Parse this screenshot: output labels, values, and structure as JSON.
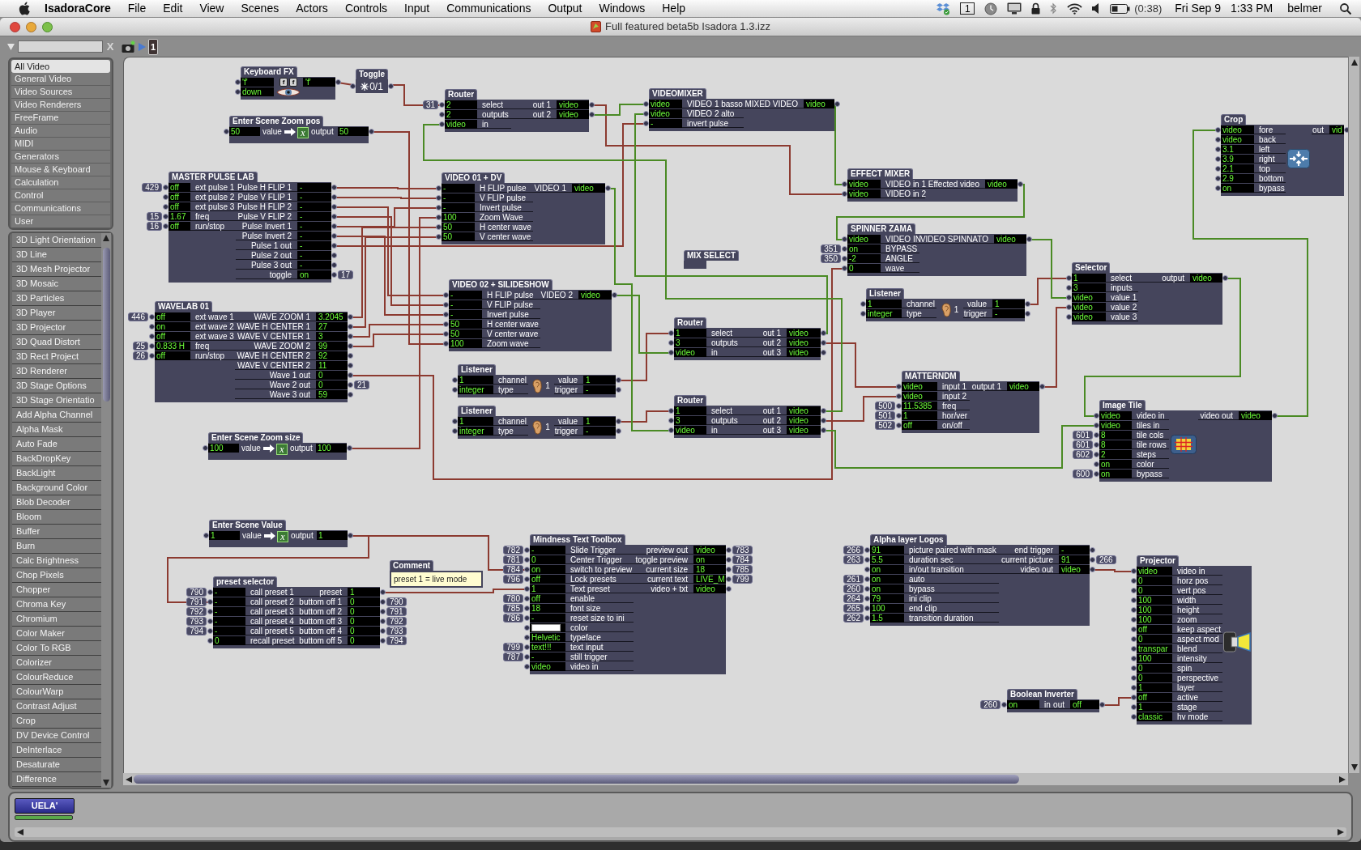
{
  "menu_bar": {
    "app": "IsadoraCore",
    "menus": [
      "File",
      "Edit",
      "View",
      "Scenes",
      "Actors",
      "Controls",
      "Input",
      "Communications",
      "Output",
      "Windows",
      "Help"
    ],
    "space": "1",
    "battery": "(0:38)",
    "date": "Fri Sep 9",
    "time": "1:33 PM",
    "user": "belmer"
  },
  "window": {
    "title": "Full featured beta5b Isadora 1.3.izz"
  },
  "toolbar": {
    "clear": "X",
    "page": "1"
  },
  "sidebar": {
    "categories": [
      {
        "label": "All Video",
        "selected": true
      },
      {
        "label": "General Video",
        "selected": false
      },
      {
        "label": "Video Sources",
        "selected": false
      },
      {
        "label": "Video Renderers",
        "selected": false
      },
      {
        "label": "FreeFrame",
        "selected": false
      },
      {
        "label": "Audio",
        "selected": false
      },
      {
        "label": "MIDI",
        "selected": false
      },
      {
        "label": "Generators",
        "selected": false
      },
      {
        "label": "Mouse & Keyboard",
        "selected": false
      },
      {
        "label": "Calculation",
        "selected": false
      },
      {
        "label": "Control",
        "selected": false
      },
      {
        "label": "Communications",
        "selected": false
      },
      {
        "label": "User",
        "selected": false
      }
    ],
    "actors": [
      "3D Light Orientation",
      "3D Line",
      "3D Mesh Projector",
      "3D Mosaic",
      "3D Particles",
      "3D Player",
      "3D Projector",
      "3D Quad Distort",
      "3D Rect Project",
      "3D Renderer",
      "3D Stage Options",
      "3D Stage Orientatio",
      "Add Alpha Channel",
      "Alpha Mask",
      "Auto Fade",
      "BackDropKey",
      "BackLight",
      "Background Color",
      "Blob Decoder",
      "Bloom",
      "Buffer",
      "Burn",
      "Calc Brightness",
      "Chop Pixels",
      "Chopper",
      "Chroma Key",
      "Chromium",
      "Color Maker",
      "Color To RGB",
      "Colorizer",
      "ColourReduce",
      "ColourWarp",
      "Contrast Adjust",
      "Crop",
      "DV Device Control",
      "DeInterlace",
      "Desaturate",
      "Difference"
    ]
  },
  "patch": {
    "actors": [
      {
        "title": "Keyboard FX",
        "kind": "ports",
        "keys": [
          "f",
          "f"
        ],
        "inputs": [
          {
            "value": "'f'"
          },
          {
            "value": "down"
          }
        ],
        "outputs": [
          {
            "value": "'f'"
          }
        ]
      },
      {
        "title": "Toggle",
        "kind": "toggle",
        "value": "0/1"
      },
      {
        "title": "Router",
        "kind": "ports",
        "inputs": [
          {
            "value": "2",
            "label": "select",
            "link": "31"
          },
          {
            "value": "2",
            "label": "outputs"
          },
          {
            "value": "video",
            "label": "in"
          }
        ],
        "outputs": [
          {
            "label": "out 1",
            "value": "video"
          },
          {
            "label": "out 2",
            "value": "video"
          }
        ]
      },
      {
        "title": "VIDEOMIXER",
        "kind": "ports",
        "inputs": [
          {
            "value": "video",
            "label": "VIDEO 1 basso"
          },
          {
            "value": "video",
            "label": "VIDEO 2 alto"
          },
          {
            "value": "-",
            "label": "invert pulse"
          }
        ],
        "outputs": [
          {
            "label": "MIXED VIDEO",
            "value": "video"
          }
        ]
      },
      {
        "title": "Enter Scene Zoom pos",
        "kind": "scene-value",
        "value": "50",
        "value_label": "value",
        "symbol": "x",
        "output_label": "output",
        "output": "50"
      },
      {
        "title": "Crop",
        "kind": "ports",
        "inputs": [
          {
            "value": "video",
            "label": "fore"
          },
          {
            "value": "video",
            "label": "back"
          },
          {
            "value": "3.1",
            "label": "left"
          },
          {
            "value": "3.9",
            "label": "right"
          },
          {
            "value": "2.1",
            "label": "top"
          },
          {
            "value": "2.9",
            "label": "bottom"
          },
          {
            "value": "on",
            "label": "bypass"
          }
        ],
        "outputs": [
          {
            "label": "out",
            "value": "vid"
          }
        ]
      },
      {
        "title": "MASTER PULSE LAB",
        "kind": "ports",
        "inputs": [
          {
            "value": "off",
            "label": "ext pulse 1",
            "link": "429"
          },
          {
            "value": "off",
            "label": "ext pulse 2"
          },
          {
            "value": "off",
            "label": "ext pulse 3"
          },
          {
            "value": "1.67",
            "label": "freq",
            "link": "15"
          },
          {
            "value": "off",
            "label": "run/stop",
            "link": "16"
          }
        ],
        "outputs": [
          {
            "label": "Pulse H FLIP 1",
            "value": "-"
          },
          {
            "label": "Pulse V FLIP 1",
            "value": "-"
          },
          {
            "label": "Pulse H FLIP 2",
            "value": "-"
          },
          {
            "label": "Pulse V FLIP 2",
            "value": "-"
          },
          {
            "label": "Pulse Invert 1",
            "value": "-"
          },
          {
            "label": "Pulse Invert 2",
            "value": "-"
          },
          {
            "label": "Pulse 1 out",
            "value": "-"
          },
          {
            "label": "Pulse 2 out",
            "value": "-"
          },
          {
            "label": "Pulse 3 out",
            "value": "-"
          },
          {
            "label": "toggle",
            "value": "on",
            "link": "17"
          }
        ]
      },
      {
        "title": "VIDEO 01 + DV",
        "kind": "ports",
        "inputs": [
          {
            "value": "-",
            "label": "H FLIP pulse"
          },
          {
            "value": "-",
            "label": "V FLIP pulse"
          },
          {
            "value": "-",
            "label": "Invert pulse"
          },
          {
            "value": "100",
            "label": "Zoom Wave"
          },
          {
            "value": "50",
            "label": "H center wave"
          },
          {
            "value": "50",
            "label": "V center wave"
          }
        ],
        "outputs": [
          {
            "label": "VIDEO 1",
            "value": "video"
          }
        ]
      },
      {
        "title": "EFFECT MIXER",
        "kind": "ports",
        "inputs": [
          {
            "value": "video",
            "label": "VIDEO in 1"
          },
          {
            "value": "video",
            "label": "VIDEO in 2"
          }
        ],
        "outputs": [
          {
            "label": "Effected video",
            "value": "video"
          }
        ]
      },
      {
        "title": "SPINNER ZAMA",
        "kind": "ports",
        "inputs": [
          {
            "value": "video",
            "label": "VIDEO IN"
          },
          {
            "value": "on",
            "label": "BYPASS",
            "link": "351"
          },
          {
            "value": "-2",
            "label": "ANGLE",
            "link": "350"
          },
          {
            "value": "0",
            "label": "wave"
          }
        ],
        "outputs": [
          {
            "label": "VIDEO SPINNATO",
            "value": "video"
          }
        ]
      },
      {
        "title": "MIX SELECT",
        "kind": "label"
      },
      {
        "title": "Selector",
        "kind": "ports",
        "inputs": [
          {
            "value": "1",
            "label": "select"
          },
          {
            "value": "3",
            "label": "inputs"
          },
          {
            "value": "video",
            "label": "value 1"
          },
          {
            "value": "video",
            "label": "value 2"
          },
          {
            "value": "video",
            "label": "value 3"
          }
        ],
        "outputs": [
          {
            "label": "output",
            "value": "video"
          }
        ]
      },
      {
        "title": "VIDEO 02 + SILIDESHOW",
        "kind": "ports",
        "inputs": [
          {
            "value": "-",
            "label": "H FLIP pulse"
          },
          {
            "value": "-",
            "label": "V FLIP pulse"
          },
          {
            "value": "-",
            "label": "Invert pulse"
          },
          {
            "value": "50",
            "label": "H center wave"
          },
          {
            "value": "50",
            "label": "V center wave"
          },
          {
            "value": "100",
            "label": "Zoom wave"
          }
        ],
        "outputs": [
          {
            "label": "VIDEO 2",
            "value": "video"
          }
        ]
      },
      {
        "title": "Listener",
        "kind": "ports",
        "readout": "1",
        "inputs": [
          {
            "value": "1",
            "label": "channel"
          },
          {
            "value": "integer",
            "label": "type"
          }
        ],
        "outputs": [
          {
            "label": "value",
            "value": "1"
          },
          {
            "label": "trigger",
            "value": "-"
          }
        ]
      },
      {
        "title": "WAVELAB 01",
        "kind": "ports",
        "inputs": [
          {
            "value": "off",
            "label": "ext wave 1",
            "link": "446"
          },
          {
            "value": "on",
            "label": "ext wave 2"
          },
          {
            "value": "off",
            "label": "ext wave 3"
          },
          {
            "value": "0.833 H",
            "label": "freq",
            "link": "25"
          },
          {
            "value": "off",
            "label": "run/stop",
            "link": "26"
          }
        ],
        "outputs": [
          {
            "label": "WAVE ZOOM 1",
            "value": "3.2045"
          },
          {
            "label": "WAVE H CENTER 1",
            "value": "27"
          },
          {
            "label": "WAVE V CENTER 1",
            "value": "3"
          },
          {
            "label": "WAVE ZOOM 2",
            "value": "99"
          },
          {
            "label": "WAVE H CENTER 2",
            "value": "92"
          },
          {
            "label": "WAVE V CENTER 2",
            "value": "11"
          },
          {
            "label": "Wave 1 out",
            "value": "0"
          },
          {
            "label": "Wave 2 out",
            "value": "0",
            "link": "21"
          },
          {
            "label": "Wave 3 out",
            "value": "59"
          }
        ]
      },
      {
        "title": "Router",
        "kind": "ports",
        "inputs": [
          {
            "value": "1",
            "label": "select"
          },
          {
            "value": "3",
            "label": "outputs"
          },
          {
            "value": "video",
            "label": "in"
          }
        ],
        "outputs": [
          {
            "label": "out 1",
            "value": "video"
          },
          {
            "label": "out 2",
            "value": "video"
          },
          {
            "label": "out 3",
            "value": "video"
          }
        ]
      },
      {
        "title": "Listener",
        "kind": "ports",
        "readout": "1",
        "inputs": [
          {
            "value": "1",
            "label": "channel"
          },
          {
            "value": "integer",
            "label": "type"
          }
        ],
        "outputs": [
          {
            "label": "value",
            "value": "1"
          },
          {
            "label": "trigger",
            "value": "-"
          }
        ]
      },
      {
        "title": "MATTERNDM",
        "kind": "ports",
        "inputs": [
          {
            "value": "video",
            "label": "input 1"
          },
          {
            "value": "video",
            "label": "input 2"
          },
          {
            "value": "11.5385",
            "label": "freq",
            "link": "500"
          },
          {
            "value": "1",
            "label": "hor/ver",
            "link": "501"
          },
          {
            "value": "off",
            "label": "on/off",
            "link": "502"
          }
        ],
        "outputs": [
          {
            "label": "output 1",
            "value": "video"
          }
        ]
      },
      {
        "title": "Router",
        "kind": "ports",
        "inputs": [
          {
            "value": "1",
            "label": "select"
          },
          {
            "value": "3",
            "label": "outputs"
          },
          {
            "value": "video",
            "label": "in"
          }
        ],
        "outputs": [
          {
            "label": "out 1",
            "value": "video"
          },
          {
            "label": "out 2",
            "value": "video"
          },
          {
            "label": "out 3",
            "value": "video"
          }
        ]
      },
      {
        "title": "Image Tile",
        "kind": "ports",
        "inputs": [
          {
            "value": "video",
            "label": "video in"
          },
          {
            "value": "video",
            "label": "tiles in"
          },
          {
            "value": "8",
            "label": "tile cols",
            "link": "601"
          },
          {
            "value": "8",
            "label": "tile rows",
            "link": "601"
          },
          {
            "value": "2",
            "label": "steps",
            "link": "602"
          },
          {
            "value": "on",
            "label": "color"
          },
          {
            "value": "on",
            "label": "bypass",
            "link": "600"
          }
        ],
        "outputs": [
          {
            "label": "video out",
            "value": "video"
          }
        ]
      },
      {
        "title": "Listener",
        "kind": "ports",
        "readout": "1",
        "inputs": [
          {
            "value": "1",
            "label": "channel"
          },
          {
            "value": "integer",
            "label": "type"
          }
        ],
        "outputs": [
          {
            "label": "value",
            "value": "1"
          },
          {
            "label": "trigger",
            "value": "-"
          }
        ]
      },
      {
        "title": "Enter Scene Zoom size",
        "kind": "scene-value",
        "value": "100",
        "value_label": "value",
        "symbol": "x",
        "output_label": "output",
        "output": "100"
      },
      {
        "title": "Enter Scene Value",
        "kind": "scene-value",
        "value": "1",
        "value_label": "value",
        "symbol": "x",
        "output_label": "output",
        "output": "1"
      },
      {
        "title": "Mindness Text Toolbox",
        "kind": "ports",
        "inputs": [
          {
            "value": "-",
            "label": "Slide Trigger",
            "link": "782"
          },
          {
            "value": "0",
            "label": "Center Trigger",
            "link": "781"
          },
          {
            "value": "on",
            "label": "switch to preview",
            "link": "784"
          },
          {
            "value": "off",
            "label": "Lock presets",
            "link": "796"
          },
          {
            "value": "1",
            "label": "Text preset"
          },
          {
            "value": "off",
            "label": "enable",
            "link": "780"
          },
          {
            "value": "18",
            "label": "font size",
            "link": "785"
          },
          {
            "value": "-",
            "label": "reset size to ini",
            "link": "786"
          },
          {
            "color": "#ffffff",
            "label": "color"
          },
          {
            "value": "Helvetic",
            "label": "typeface"
          },
          {
            "value": "text!!!",
            "label": "text input",
            "link": "799"
          },
          {
            "value": "-",
            "label": "still trigger",
            "link": "787"
          },
          {
            "value": "video",
            "label": "video in"
          }
        ],
        "outputs": [
          {
            "label": "preview out",
            "value": "video",
            "link": "783"
          },
          {
            "label": "toggle preview",
            "value": "on",
            "link": "784"
          },
          {
            "label": "current size",
            "value": "18",
            "link": "785"
          },
          {
            "label": "current text",
            "value": "LIVE_M",
            "link": "799"
          },
          {
            "label": "video + txt",
            "value": "video"
          }
        ]
      },
      {
        "title": "Alpha layer Logos",
        "kind": "ports",
        "inputs": [
          {
            "value": "91",
            "label": "picture paired with mask",
            "link": "266"
          },
          {
            "value": "5.5",
            "label": "duration sec",
            "link": "263"
          },
          {
            "value": "on",
            "label": "in/out transition"
          },
          {
            "value": "on",
            "label": "auto",
            "link": "261"
          },
          {
            "value": "on",
            "label": "bypass",
            "link": "260"
          },
          {
            "value": "79",
            "label": "ini clip",
            "link": "264"
          },
          {
            "value": "100",
            "label": "end clip",
            "link": "265"
          },
          {
            "value": "1.5",
            "label": "transition duration",
            "link": "262"
          }
        ],
        "outputs": [
          {
            "label": "end trigger",
            "value": "-"
          },
          {
            "label": "current picture",
            "value": "91",
            "link": "266"
          },
          {
            "label": "video out",
            "value": "video"
          }
        ]
      },
      {
        "title": "Projector",
        "kind": "ports",
        "inputs": [
          {
            "value": "video",
            "label": "video in"
          },
          {
            "value": "0",
            "label": "horz pos"
          },
          {
            "value": "0",
            "label": "vert pos"
          },
          {
            "value": "100",
            "label": "width"
          },
          {
            "value": "100",
            "label": "height"
          },
          {
            "value": "100",
            "label": "zoom"
          },
          {
            "value": "off",
            "label": "keep aspect"
          },
          {
            "value": "0",
            "label": "aspect mod"
          },
          {
            "value": "transpar",
            "label": "blend"
          },
          {
            "value": "100",
            "label": "intensity"
          },
          {
            "value": "0",
            "label": "spin"
          },
          {
            "value": "0",
            "label": "perspective"
          },
          {
            "value": "1",
            "label": "layer"
          },
          {
            "value": "off",
            "label": "active"
          },
          {
            "value": "1",
            "label": "stage"
          },
          {
            "value": "classic",
            "label": "hv mode"
          }
        ]
      },
      {
        "title": "Comment",
        "kind": "comment",
        "text": "preset 1 = live mode"
      },
      {
        "title": "preset selector",
        "kind": "ports",
        "inputs": [
          {
            "value": "-",
            "label": "call preset 1",
            "link": "790"
          },
          {
            "value": "-",
            "label": "call preset 2",
            "link": "791"
          },
          {
            "value": "-",
            "label": "call preset 3",
            "link": "792"
          },
          {
            "value": "-",
            "label": "call preset 4",
            "link": "793"
          },
          {
            "value": "-",
            "label": "call preset 5",
            "link": "794"
          },
          {
            "value": "0",
            "label": "recall preset"
          }
        ],
        "outputs": [
          {
            "label": "preset",
            "value": "1"
          },
          {
            "label": "buttom off 1",
            "value": "0",
            "link": "790"
          },
          {
            "label": "buttom off 2",
            "value": "0",
            "link": "791"
          },
          {
            "label": "buttom off 3",
            "value": "0",
            "link": "792"
          },
          {
            "label": "buttom off 4",
            "value": "0",
            "link": "793"
          },
          {
            "label": "buttom off 5",
            "value": "0",
            "link": "794"
          }
        ]
      },
      {
        "title": "Boolean Inverter",
        "kind": "ports",
        "inputs": [
          {
            "value": "on",
            "label": "in",
            "link": "260"
          }
        ],
        "outputs": [
          {
            "label": "out",
            "value": "off"
          }
        ]
      }
    ]
  },
  "scenes": [
    {
      "label": "UELA'",
      "selected": true
    }
  ]
}
